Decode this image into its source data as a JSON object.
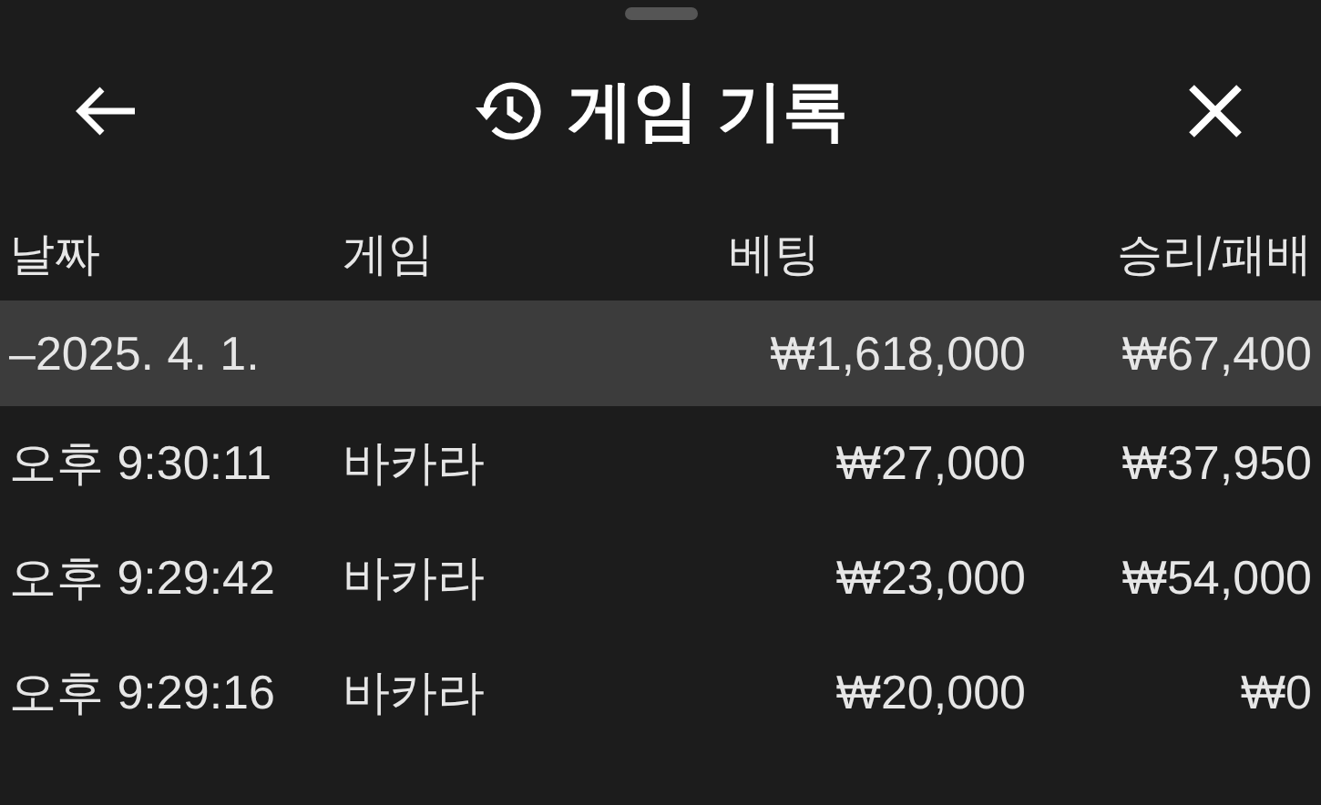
{
  "header": {
    "title": "게임 기록"
  },
  "table": {
    "columns": [
      "날짜",
      "게임",
      "베팅",
      "승리/패배"
    ],
    "groups": [
      {
        "date": "–2025. 4. 1.",
        "bet": "₩1,618,000",
        "result": "₩67,400",
        "rows": [
          {
            "time": "오후 9:30:11",
            "game": "바카라",
            "bet": "₩27,000",
            "result": "₩37,950"
          },
          {
            "time": "오후 9:29:42",
            "game": "바카라",
            "bet": "₩23,000",
            "result": "₩54,000"
          },
          {
            "time": "오후 9:29:16",
            "game": "바카라",
            "bet": "₩20,000",
            "result": "₩0"
          }
        ]
      }
    ]
  }
}
